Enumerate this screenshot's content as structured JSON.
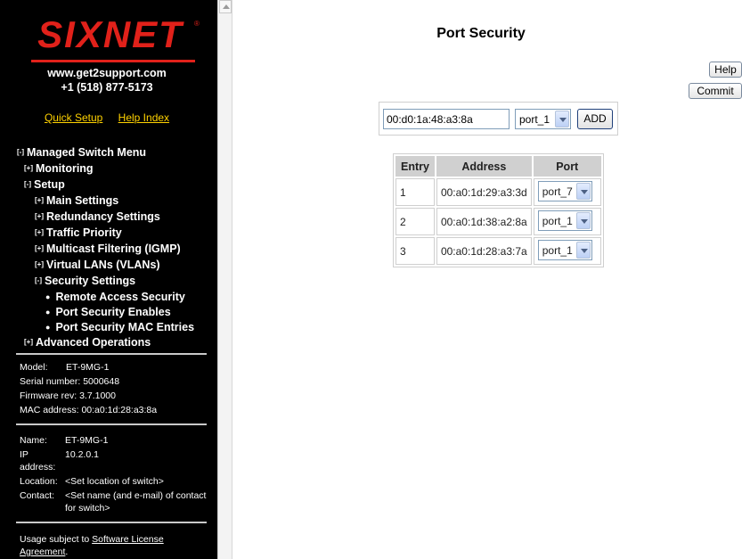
{
  "sidebar": {
    "logo": "SIXNET",
    "support_url": "www.get2support.com",
    "support_phone": "+1 (518) 877-5173",
    "quick_setup": "Quick Setup",
    "help_index": "Help Index",
    "menu": {
      "root": {
        "toggle": "[-]",
        "label": "Managed Switch Menu"
      },
      "monitoring": {
        "toggle": "[+]",
        "label": "Monitoring"
      },
      "setup": {
        "toggle": "[-]",
        "label": "Setup"
      },
      "main_settings": {
        "toggle": "[+]",
        "label": "Main Settings"
      },
      "redundancy": {
        "toggle": "[+]",
        "label": "Redundancy Settings"
      },
      "traffic": {
        "toggle": "[+]",
        "label": "Traffic Priority"
      },
      "multicast": {
        "toggle": "[+]",
        "label": "Multicast Filtering (IGMP)"
      },
      "vlans": {
        "toggle": "[+]",
        "label": "Virtual LANs (VLANs)"
      },
      "security": {
        "toggle": "[-]",
        "label": "Security Settings"
      },
      "remote_access": "Remote Access Security",
      "port_sec_enables": "Port Security Enables",
      "port_sec_mac": "Port Security MAC Entries",
      "advanced": {
        "toggle": "[+]",
        "label": "Advanced Operations"
      }
    },
    "device": {
      "model_label": "Model:",
      "model": "ET-9MG-1",
      "serial_label": "Serial number:",
      "serial": "5000648",
      "firmware_label": "Firmware rev:",
      "firmware": "3.7.1000",
      "mac_label": "MAC address:",
      "mac": "00:a0:1d:28:a3:8a"
    },
    "identity": {
      "name_label": "Name:",
      "name": "ET-9MG-1",
      "ip_label_1": "IP",
      "ip_label_2": "address:",
      "ip": "10.2.0.1",
      "location_label": "Location:",
      "location": "<Set location of switch>",
      "contact_label": "Contact:",
      "contact_1": "<Set name (and e-mail) of contact",
      "contact_2": "for switch>"
    },
    "license": {
      "prefix": "Usage subject to ",
      "link_1": "Software License",
      "link_2": "Agreement",
      "suffix": "."
    }
  },
  "main": {
    "title": "Port Security",
    "help": "Help",
    "commit": "Commit",
    "mac_input_value": "00:d0:1a:48:a3:8a",
    "port_select_value": "port_1",
    "add": "ADD",
    "table": {
      "headers": [
        "Entry",
        "Address",
        "Port"
      ],
      "rows": [
        {
          "entry": "1",
          "address": "00:a0:1d:29:a3:3d",
          "port": "port_7"
        },
        {
          "entry": "2",
          "address": "00:a0:1d:38:a2:8a",
          "port": "port_1"
        },
        {
          "entry": "3",
          "address": "00:a0:1d:28:a3:7a",
          "port": "port_1"
        }
      ]
    }
  }
}
